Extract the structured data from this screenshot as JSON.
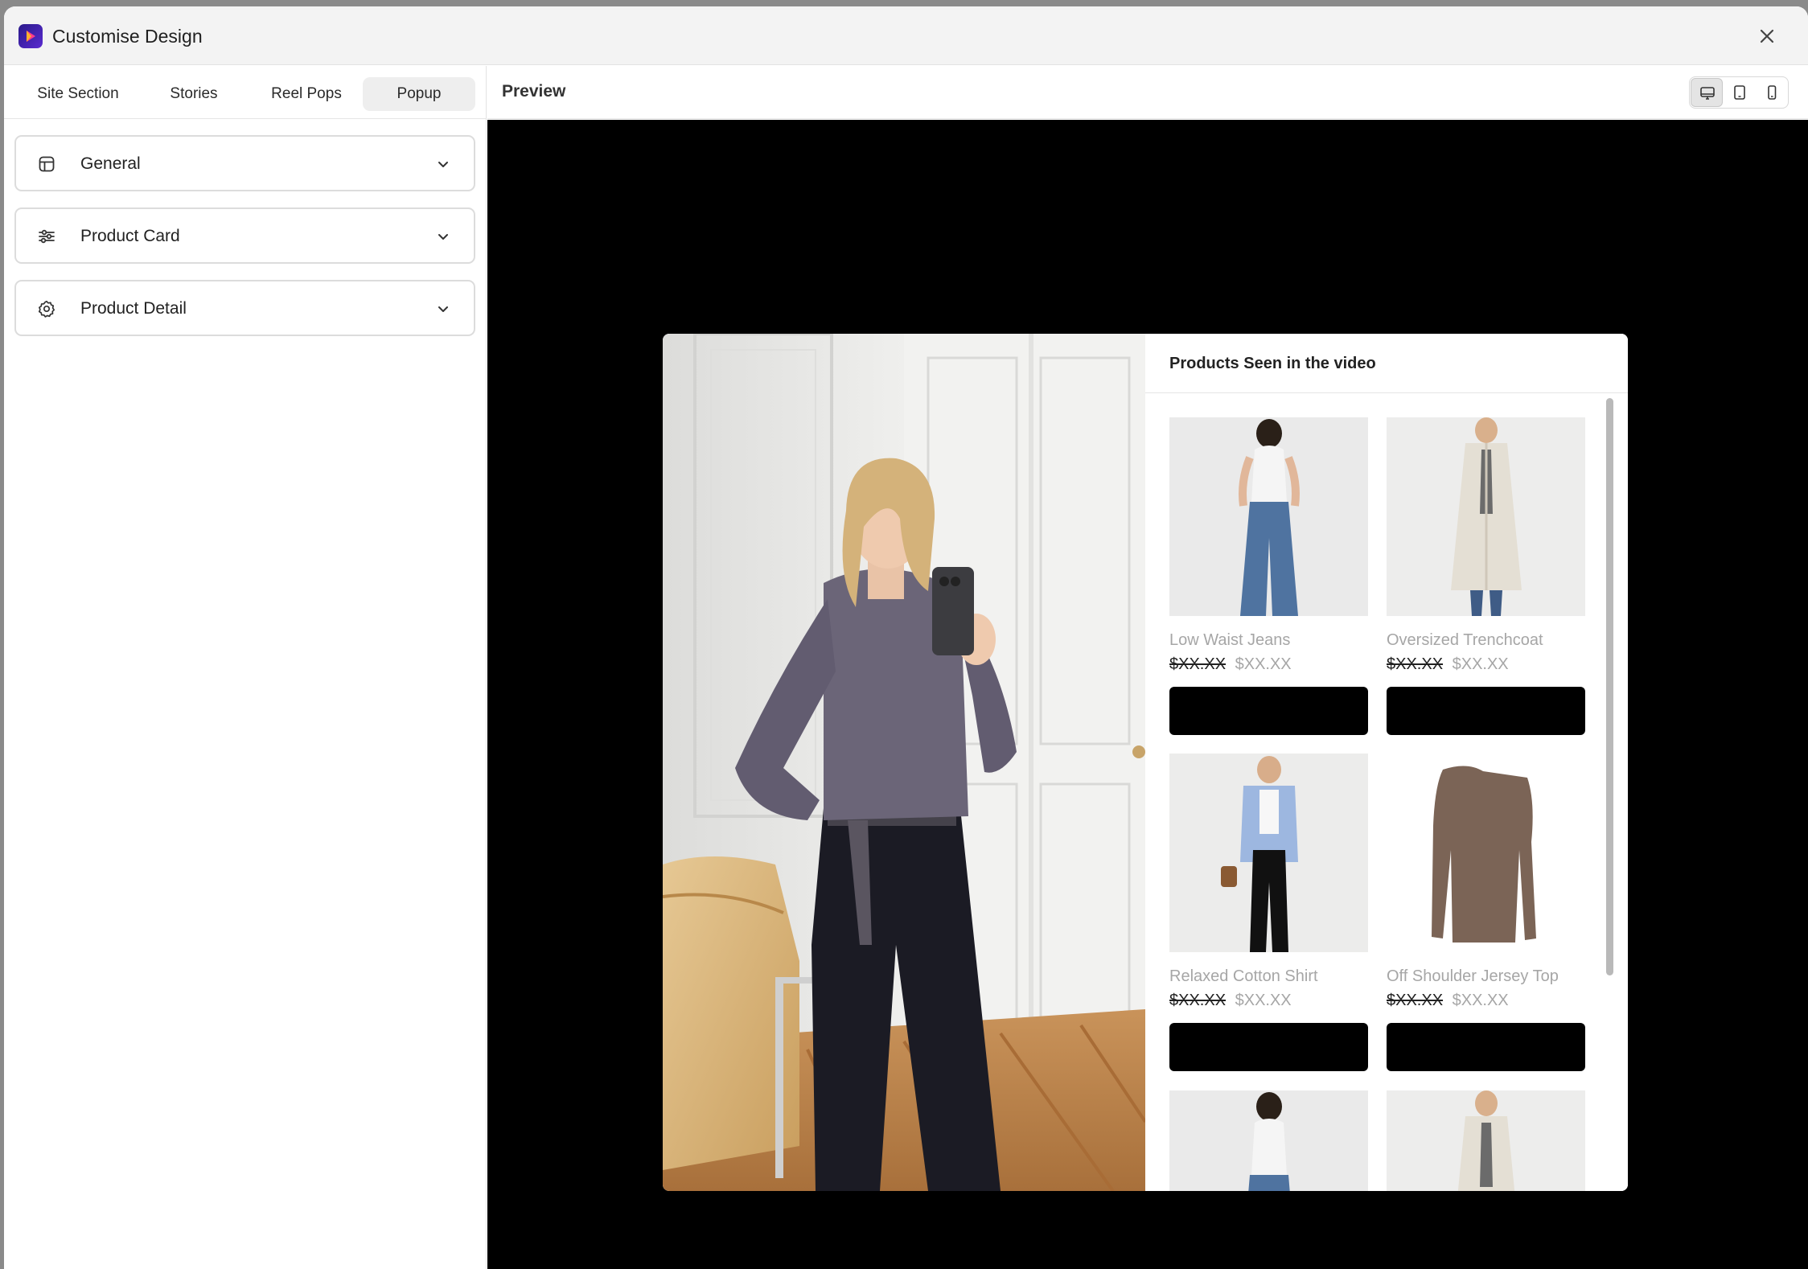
{
  "window": {
    "title": "Customise Design"
  },
  "tabs": [
    {
      "label": "Site Section",
      "active": false
    },
    {
      "label": "Stories",
      "active": false
    },
    {
      "label": "Reel Pops",
      "active": false
    },
    {
      "label": "Popup",
      "active": true
    }
  ],
  "sections": [
    {
      "label": "General",
      "icon": "layout-icon"
    },
    {
      "label": "Product Card",
      "icon": "sliders-icon"
    },
    {
      "label": "Product Detail",
      "icon": "gear-icon"
    }
  ],
  "preview": {
    "title": "Preview",
    "devices": [
      {
        "name": "desktop",
        "active": true
      },
      {
        "name": "tablet",
        "active": false
      },
      {
        "name": "mobile",
        "active": false
      }
    ]
  },
  "popup": {
    "panel_title": "Products Seen in the video",
    "products": [
      {
        "name": "Low Waist Jeans",
        "price_old": "$XX.XX",
        "price_new": "$XX.XX",
        "image": "jeans"
      },
      {
        "name": "Oversized Trenchcoat",
        "price_old": "$XX.XX",
        "price_new": "$XX.XX",
        "image": "trenchcoat"
      },
      {
        "name": "Relaxed Cotton Shirt",
        "price_old": "$XX.XX",
        "price_new": "$XX.XX",
        "image": "shirt"
      },
      {
        "name": "Off Shoulder Jersey Top",
        "price_old": "$XX.XX",
        "price_new": "$XX.XX",
        "image": "jersey"
      },
      {
        "name": "",
        "price_old": "",
        "price_new": "",
        "image": "jeans"
      },
      {
        "name": "",
        "price_old": "",
        "price_new": "",
        "image": "trenchcoat"
      }
    ]
  }
}
